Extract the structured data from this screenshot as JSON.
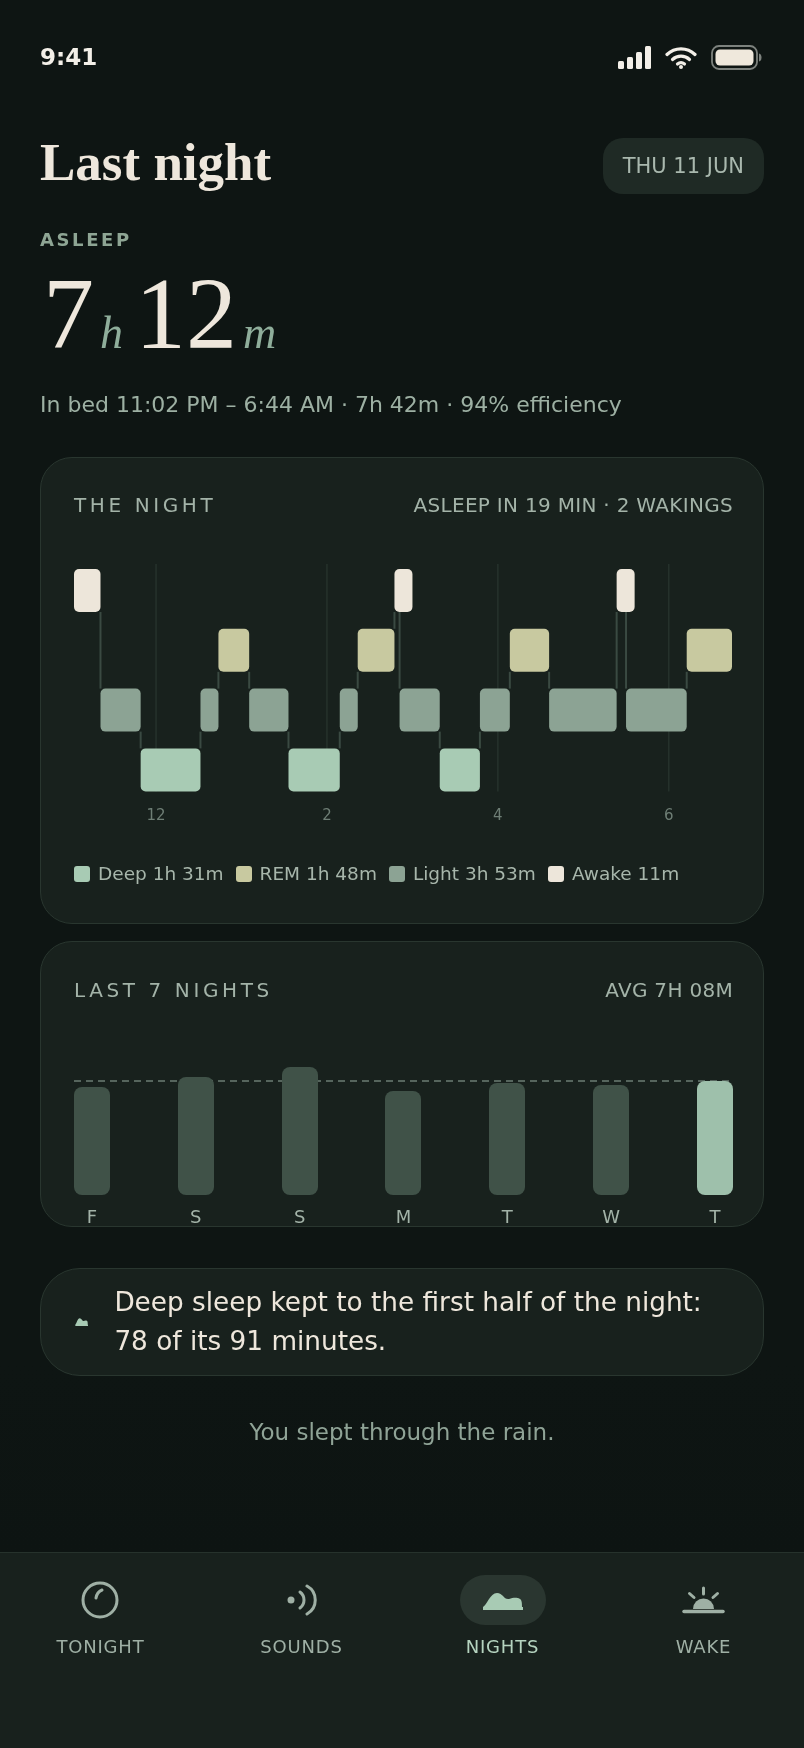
{
  "status_bar": {
    "time": "9:41"
  },
  "header": {
    "title": "Last night",
    "date": "THU 11 JUN"
  },
  "summary": {
    "label": "ASLEEP",
    "hours": "7",
    "hours_unit": "h",
    "minutes": "12",
    "minutes_unit": "m",
    "details": "In bed 11:02 PM – 6:44 AM · 7h 42m · 94% efficiency"
  },
  "night_card": {
    "title": "THE NIGHT",
    "stats": "ASLEEP IN 19 MIN · 2 WAKINGS",
    "hour_labels": [
      "12",
      "2",
      "4",
      "6"
    ],
    "legend": [
      {
        "label": "Deep 1h 31m",
        "color": "#a8cbb4"
      },
      {
        "label": "REM 1h 48m",
        "color": "#c8c9a0"
      },
      {
        "label": "Light 3h 53m",
        "color": "#8ca394"
      },
      {
        "label": "Awake 11m",
        "color": "#ede6da"
      }
    ]
  },
  "week_card": {
    "title": "LAST 7 NIGHTS",
    "average": "AVG 7H 08M",
    "nights": [
      {
        "day": "F",
        "selected": false
      },
      {
        "day": "S",
        "selected": false
      },
      {
        "day": "S",
        "selected": false
      },
      {
        "day": "M",
        "selected": false
      },
      {
        "day": "T",
        "selected": false
      },
      {
        "day": "W",
        "selected": false
      },
      {
        "day": "T",
        "selected": true
      }
    ]
  },
  "insight": {
    "text": "Deep sleep kept to the first half of the night: 78 of its 91 minutes."
  },
  "footer_note": "You slept through the rain.",
  "tab_bar": [
    {
      "label": "TONIGHT",
      "kind": "dial",
      "selected": false
    },
    {
      "label": "SOUNDS",
      "kind": "waves",
      "selected": false
    },
    {
      "label": "NIGHTS",
      "kind": "hills",
      "selected": true
    },
    {
      "label": "WAKE",
      "kind": "sunrise",
      "selected": false
    }
  ]
}
